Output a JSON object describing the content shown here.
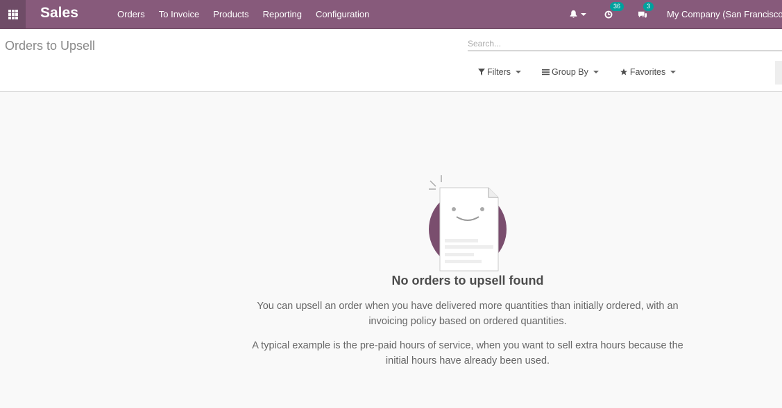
{
  "navbar": {
    "apps_icon": "apps-grid-icon",
    "brand": "Sales",
    "menu": [
      "Orders",
      "To Invoice",
      "Products",
      "Reporting",
      "Configuration"
    ],
    "activity_count": "36",
    "messages_count": "3",
    "company": "My Company (San Francisco)"
  },
  "control_panel": {
    "title": "Orders to Upsell",
    "search_placeholder": "Search...",
    "filters_label": "Filters",
    "groupby_label": "Group By",
    "favorites_label": "Favorites"
  },
  "empty_state": {
    "title": "No orders to upsell found",
    "paragraph1": "You can upsell an order when you have delivered more quantities than initially ordered, with an invoicing policy based on ordered quantities.",
    "paragraph2": "A typical example is the pre-paid hours of service, when you want to sell extra hours because the initial hours have already been used."
  },
  "colors": {
    "brand": "#875a7b",
    "badge": "#00a09d"
  }
}
